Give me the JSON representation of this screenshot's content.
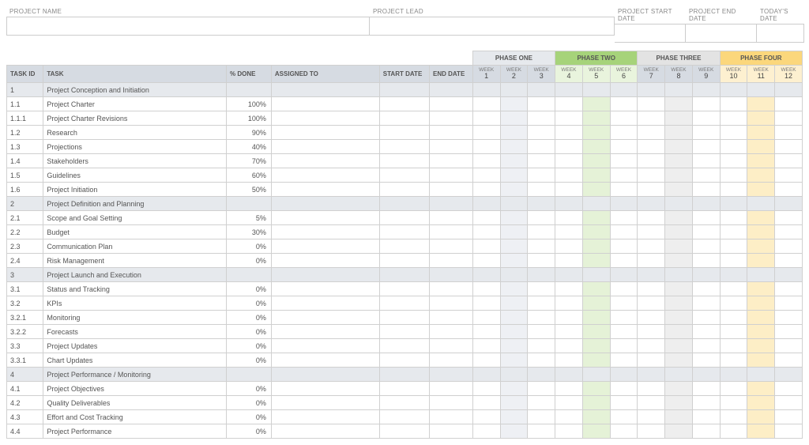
{
  "top_fields": {
    "name": {
      "label": "PROJECT NAME",
      "value": ""
    },
    "lead": {
      "label": "PROJECT LEAD",
      "value": ""
    },
    "start": {
      "label": "PROJECT START DATE",
      "value": ""
    },
    "end": {
      "label": "PROJECT END DATE",
      "value": ""
    },
    "today": {
      "label": "TODAY'S DATE",
      "value": ""
    }
  },
  "phases": [
    {
      "label": "PHASE ONE",
      "cls": "phase1",
      "weeks": [
        1,
        2,
        3
      ]
    },
    {
      "label": "PHASE TWO",
      "cls": "phase2",
      "weeks": [
        4,
        5,
        6
      ]
    },
    {
      "label": "PHASE THREE",
      "cls": "phase3",
      "weeks": [
        7,
        8,
        9
      ]
    },
    {
      "label": "PHASE FOUR",
      "cls": "phase4",
      "weeks": [
        10,
        11,
        12
      ]
    }
  ],
  "week_label": "WEEK",
  "columns": {
    "task_id": "TASK ID",
    "task": "TASK",
    "pct_done": "% DONE",
    "assigned_to": "ASSIGNED TO",
    "start_date": "START DATE",
    "end_date": "END DATE"
  },
  "highlight_weeks": {
    "1": 2,
    "2": 5,
    "3": 8,
    "4": 11
  },
  "rows": [
    {
      "id": "1",
      "task": "Project Conception and Initiation",
      "done": "",
      "section": true
    },
    {
      "id": "1.1",
      "task": "Project Charter",
      "done": "100%"
    },
    {
      "id": "1.1.1",
      "task": "Project Charter Revisions",
      "done": "100%"
    },
    {
      "id": "1.2",
      "task": "Research",
      "done": "90%"
    },
    {
      "id": "1.3",
      "task": "Projections",
      "done": "40%"
    },
    {
      "id": "1.4",
      "task": "Stakeholders",
      "done": "70%"
    },
    {
      "id": "1.5",
      "task": "Guidelines",
      "done": "60%"
    },
    {
      "id": "1.6",
      "task": "Project Initiation",
      "done": "50%"
    },
    {
      "id": "2",
      "task": "Project Definition and Planning",
      "done": "",
      "section": true
    },
    {
      "id": "2.1",
      "task": "Scope and Goal Setting",
      "done": "5%"
    },
    {
      "id": "2.2",
      "task": "Budget",
      "done": "30%"
    },
    {
      "id": "2.3",
      "task": "Communication Plan",
      "done": "0%"
    },
    {
      "id": "2.4",
      "task": "Risk Management",
      "done": "0%"
    },
    {
      "id": "3",
      "task": "Project Launch and Execution",
      "done": "",
      "section": true
    },
    {
      "id": "3.1",
      "task": "Status and Tracking",
      "done": "0%"
    },
    {
      "id": "3.2",
      "task": "KPIs",
      "done": "0%"
    },
    {
      "id": "3.2.1",
      "task": "Monitoring",
      "done": "0%"
    },
    {
      "id": "3.2.2",
      "task": "Forecasts",
      "done": "0%"
    },
    {
      "id": "3.3",
      "task": "Project Updates",
      "done": "0%"
    },
    {
      "id": "3.3.1",
      "task": "Chart Updates",
      "done": "0%"
    },
    {
      "id": "4",
      "task": "Project Performance / Monitoring",
      "done": "",
      "section": true
    },
    {
      "id": "4.1",
      "task": "Project Objectives",
      "done": "0%"
    },
    {
      "id": "4.2",
      "task": "Quality Deliverables",
      "done": "0%"
    },
    {
      "id": "4.3",
      "task": "Effort and Cost Tracking",
      "done": "0%"
    },
    {
      "id": "4.4",
      "task": "Project Performance",
      "done": "0%"
    }
  ]
}
